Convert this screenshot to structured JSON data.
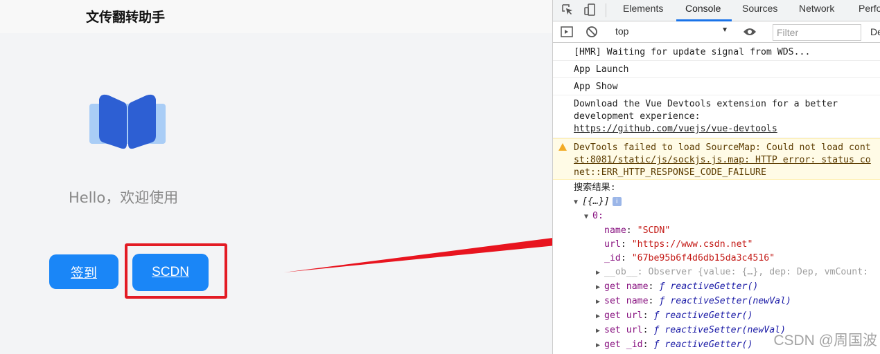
{
  "app": {
    "title": "文传翻转助手",
    "greeting": "Hello，欢迎使用",
    "buttons": {
      "sign_in": "签到",
      "csdn": "SCDN"
    },
    "colors": {
      "button": "#1a86f7",
      "highlight": "#e31b24",
      "logo_dark": "#2d5fd3",
      "logo_light": "#a9cdf6"
    }
  },
  "devtools": {
    "icons": [
      "inspect-icon",
      "device-toggle-icon",
      "sidebar-toggle-icon",
      "clear-console-icon",
      "eye-icon"
    ],
    "tabs": [
      "Elements",
      "Console",
      "Sources",
      "Network",
      "Perfo"
    ],
    "active_tab": "Console",
    "context": "top",
    "filter_placeholder": "Filter",
    "trailing_text": "De",
    "messages": {
      "hmr": "[HMR] Waiting for update signal from WDS...",
      "launch": "App Launch",
      "show": "App Show",
      "vue_line1": "Download the Vue Devtools extension for a better",
      "vue_line2": "development experience:",
      "vue_link": "https://github.com/vuejs/vue-devtools",
      "warn_line1": "DevTools failed to load SourceMap: Could not load cont",
      "warn_line2": "st:8081/static/js/sockjs.js.map: HTTP error: status co",
      "warn_line3": "net::ERR_HTTP_RESPONSE_CODE_FAILURE",
      "search_label": "搜索结果:"
    },
    "tree": {
      "array": "[{…}]",
      "index": "0:",
      "name_key": "name",
      "name_val": "\"SCDN\"",
      "url_key": "url",
      "url_val": "\"https://www.csdn.net\"",
      "id_key": "_id",
      "id_val": "\"67be95b6f4d6db15da3c4516\"",
      "ob_key": "__ob__",
      "ob_val": ": Observer {value: {…}, dep: Dep, vmCount:",
      "getters": [
        {
          "key": "get name",
          "fn": "reactiveGetter()"
        },
        {
          "key": "set name",
          "fn": "reactiveSetter(newVal)"
        },
        {
          "key": "get url",
          "fn": "reactiveGetter()"
        },
        {
          "key": "set url",
          "fn": "reactiveSetter(newVal)"
        },
        {
          "key": "get _id",
          "fn": "reactiveGetter()"
        }
      ]
    }
  },
  "watermark": "CSDN @周国波"
}
